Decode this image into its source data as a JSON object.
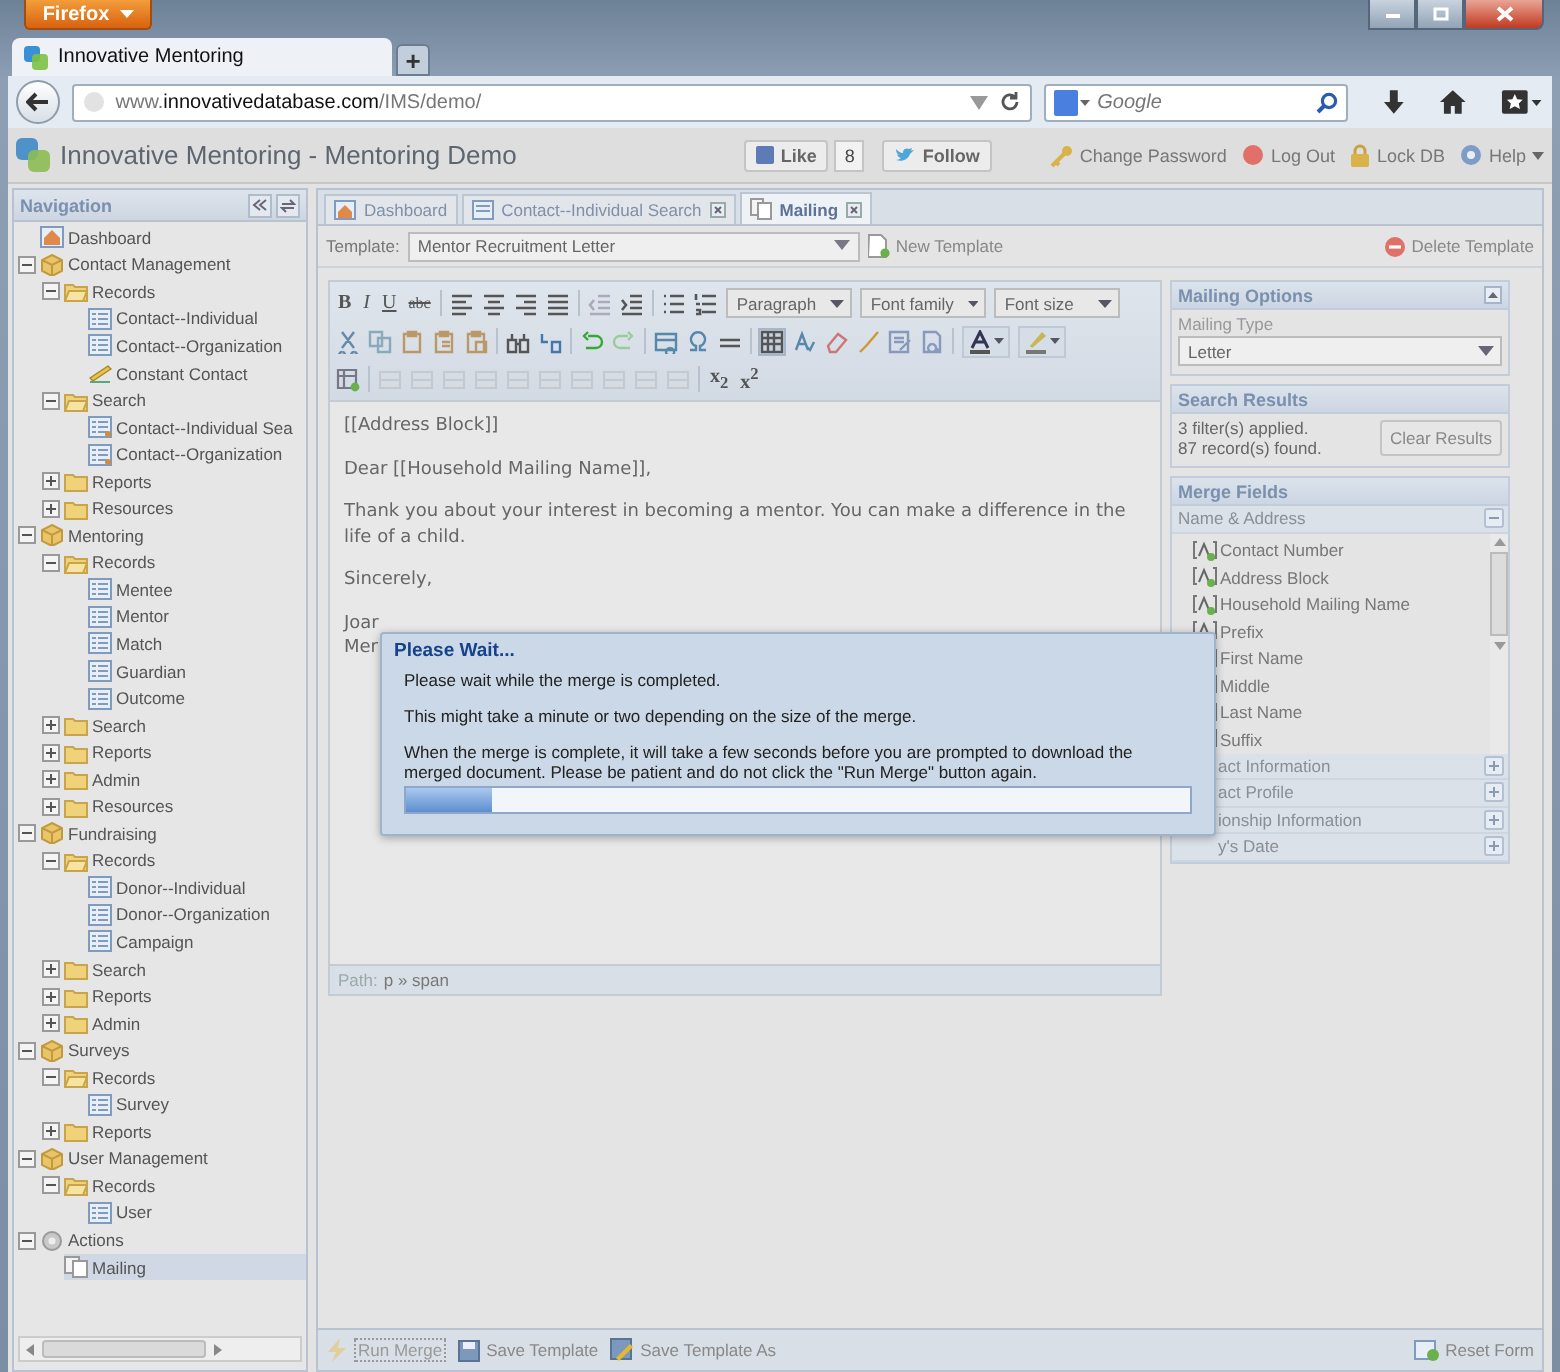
{
  "browser": {
    "app_button": "Firefox",
    "tabs": [
      {
        "title": "Innovative Mentoring",
        "selected": true
      }
    ],
    "new_tab": "+",
    "url": {
      "host_prefix": "www.",
      "host": "innovativedatabase.com",
      "path": "/IMS/demo/"
    },
    "search": {
      "placeholder": "Google"
    }
  },
  "header": {
    "title": "Innovative Mentoring - Mentoring Demo",
    "like": "Like",
    "like_count": "8",
    "follow": "Follow",
    "links": [
      {
        "kind": "key",
        "label": "Change Password"
      },
      {
        "kind": "logout",
        "label": "Log Out"
      },
      {
        "kind": "lock",
        "label": "Lock DB"
      },
      {
        "kind": "help",
        "label": "Help"
      }
    ]
  },
  "navigation": {
    "title": "Navigation",
    "tree": [
      {
        "label": "Dashboard",
        "kind": "dashboard",
        "selected": false
      },
      {
        "label": "Contact Management",
        "kind": "module",
        "expanded": true,
        "selected": false,
        "children": [
          {
            "label": "Records",
            "kind": "folder",
            "expanded": true,
            "selected": false,
            "children": [
              {
                "label": "Contact--Individual",
                "kind": "form",
                "selected": false
              },
              {
                "label": "Contact--Organization",
                "kind": "form",
                "selected": false
              },
              {
                "label": "Constant Contact",
                "kind": "sync",
                "selected": false
              }
            ]
          },
          {
            "label": "Search",
            "kind": "folder",
            "expanded": true,
            "selected": false,
            "children": [
              {
                "label": "Contact--Individual Sea",
                "kind": "search",
                "selected": false
              },
              {
                "label": "Contact--Organization",
                "kind": "search",
                "selected": false
              }
            ]
          },
          {
            "label": "Reports",
            "kind": "folder",
            "expanded": false,
            "selected": false
          },
          {
            "label": "Resources",
            "kind": "folder",
            "expanded": false,
            "selected": false
          }
        ]
      },
      {
        "label": "Mentoring",
        "kind": "module",
        "expanded": true,
        "selected": false,
        "children": [
          {
            "label": "Records",
            "kind": "folder",
            "expanded": true,
            "selected": false,
            "children": [
              {
                "label": "Mentee",
                "kind": "form",
                "selected": false
              },
              {
                "label": "Mentor",
                "kind": "form",
                "selected": false
              },
              {
                "label": "Match",
                "kind": "form",
                "selected": false
              },
              {
                "label": "Guardian",
                "kind": "form",
                "selected": false
              },
              {
                "label": "Outcome",
                "kind": "form",
                "selected": false
              }
            ]
          },
          {
            "label": "Search",
            "kind": "folder",
            "expanded": false,
            "selected": false
          },
          {
            "label": "Reports",
            "kind": "folder",
            "expanded": false,
            "selected": false
          },
          {
            "label": "Admin",
            "kind": "folder",
            "expanded": false,
            "selected": false
          },
          {
            "label": "Resources",
            "kind": "folder",
            "expanded": false,
            "selected": false
          }
        ]
      },
      {
        "label": "Fundraising",
        "kind": "module",
        "expanded": true,
        "selected": false,
        "children": [
          {
            "label": "Records",
            "kind": "folder",
            "expanded": true,
            "selected": false,
            "children": [
              {
                "label": "Donor--Individual",
                "kind": "form",
                "selected": false
              },
              {
                "label": "Donor--Organization",
                "kind": "form",
                "selected": false
              },
              {
                "label": "Campaign",
                "kind": "form",
                "selected": false
              }
            ]
          },
          {
            "label": "Search",
            "kind": "folder",
            "expanded": false,
            "selected": false
          },
          {
            "label": "Reports",
            "kind": "folder",
            "expanded": false,
            "selected": false
          },
          {
            "label": "Admin",
            "kind": "folder",
            "expanded": false,
            "selected": false
          }
        ]
      },
      {
        "label": "Surveys",
        "kind": "module",
        "expanded": true,
        "selected": false,
        "children": [
          {
            "label": "Records",
            "kind": "folder",
            "expanded": true,
            "selected": false,
            "children": [
              {
                "label": "Survey",
                "kind": "form",
                "selected": false
              }
            ]
          },
          {
            "label": "Reports",
            "kind": "folder",
            "expanded": false,
            "selected": false
          }
        ]
      },
      {
        "label": "User Management",
        "kind": "module",
        "expanded": true,
        "selected": false,
        "children": [
          {
            "label": "Records",
            "kind": "folder",
            "expanded": true,
            "selected": false,
            "children": [
              {
                "label": "User",
                "kind": "form",
                "selected": false
              }
            ]
          }
        ]
      },
      {
        "label": "Actions",
        "kind": "actions",
        "expanded": true,
        "selected": false,
        "children": [
          {
            "label": "Mailing",
            "kind": "mailing",
            "selected": true
          }
        ]
      }
    ]
  },
  "tabs": [
    {
      "label": "Dashboard",
      "kind": "dashboard",
      "closable": false,
      "selected": false
    },
    {
      "label": "Contact--Individual Search",
      "kind": "search",
      "closable": true,
      "selected": false
    },
    {
      "label": "Mailing",
      "kind": "mailing",
      "closable": true,
      "selected": true
    }
  ],
  "template": {
    "label": "Template:",
    "value": "Mentor Recruitment Letter",
    "new_button": "New Template",
    "delete_button": "Delete Template"
  },
  "editor": {
    "format_buttons": [
      "B",
      "I",
      "U",
      "abc"
    ],
    "selects": [
      "Paragraph",
      "Font family",
      "Font size"
    ],
    "script_buttons": [
      "x$_{2}$",
      "x$^{2}$"
    ],
    "paragraphs": [
      "[[Address Block]]",
      "Dear [[Household Mailing Name]],",
      "Thank you about your interest in becoming a mentor.  You can make a difference in the life of a child.",
      "Sincerely,"
    ],
    "cut_lines": [
      "Joar",
      "Mer"
    ],
    "path_label": "Path:",
    "path": "p » span"
  },
  "mailing_options": {
    "title": "Mailing Options",
    "type_label": "Mailing Type",
    "type_value": "Letter"
  },
  "search_results": {
    "title": "Search Results",
    "lines": [
      "3 filter(s) applied.",
      "87 record(s) found."
    ],
    "button": "Clear Results"
  },
  "merge_fields": {
    "title": "Merge Fields",
    "groups": [
      {
        "label": "Name & Address",
        "expanded": true,
        "items": [
          "Contact Number",
          "Address Block",
          "Household Mailing Name",
          "Prefix",
          "First Name",
          "Middle",
          "Last Name",
          "Suffix"
        ]
      },
      {
        "label": "act Information",
        "expanded": false
      },
      {
        "label": "act Profile",
        "expanded": false
      },
      {
        "label": "ionship Information",
        "expanded": false
      },
      {
        "label": "y's Date",
        "expanded": false
      }
    ]
  },
  "modal": {
    "title": "Please Wait...",
    "paragraphs": [
      "Please wait while the merge is completed.",
      "This might take a minute or two depending on the size of the merge.",
      "When the merge is complete, it will take a few seconds before you are prompted to download the merged document. Please be patient and do not click the \"Run Merge\" button again."
    ],
    "progress": {
      "level": 0.11
    }
  },
  "footer": {
    "buttons": [
      {
        "kind": "run",
        "label": "Run Merge",
        "disabled": true
      },
      {
        "kind": "save",
        "label": "Save Template",
        "disabled": false
      },
      {
        "kind": "save-as",
        "label": "Save Template As",
        "disabled": false
      }
    ],
    "reset": "Reset Form"
  }
}
